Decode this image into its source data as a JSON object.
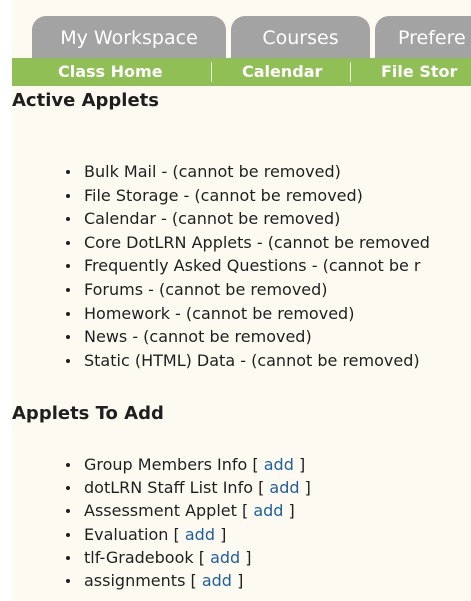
{
  "tabs": [
    {
      "label": "My Workspace"
    },
    {
      "label": "Courses"
    },
    {
      "label": "Prefere"
    }
  ],
  "subnav": [
    {
      "label": "Class Home"
    },
    {
      "label": "Calendar"
    },
    {
      "label": "File Stor"
    }
  ],
  "active_applets": {
    "heading": "Active Applets",
    "items": [
      {
        "text": "Bulk Mail - (cannot be removed)"
      },
      {
        "text": "File Storage - (cannot be removed)"
      },
      {
        "text": "Calendar - (cannot be removed)"
      },
      {
        "text": "Core DotLRN Applets - (cannot be removed"
      },
      {
        "text": "Frequently Asked Questions - (cannot be r"
      },
      {
        "text": "Forums - (cannot be removed)"
      },
      {
        "text": "Homework - (cannot be removed)"
      },
      {
        "text": "News - (cannot be removed)"
      },
      {
        "text": "Static (HTML) Data - (cannot be removed)"
      }
    ]
  },
  "applets_to_add": {
    "heading": "Applets To Add",
    "bracket_open": "[",
    "bracket_close": "]",
    "items": [
      {
        "name": "Group Members Info",
        "action": "add"
      },
      {
        "name": "dotLRN Staff List Info",
        "action": "add"
      },
      {
        "name": "Assessment Applet",
        "action": "add"
      },
      {
        "name": "Evaluation",
        "action": "add"
      },
      {
        "name": "tlf-Gradebook",
        "action": "add"
      },
      {
        "name": "assignments",
        "action": "add"
      }
    ]
  }
}
